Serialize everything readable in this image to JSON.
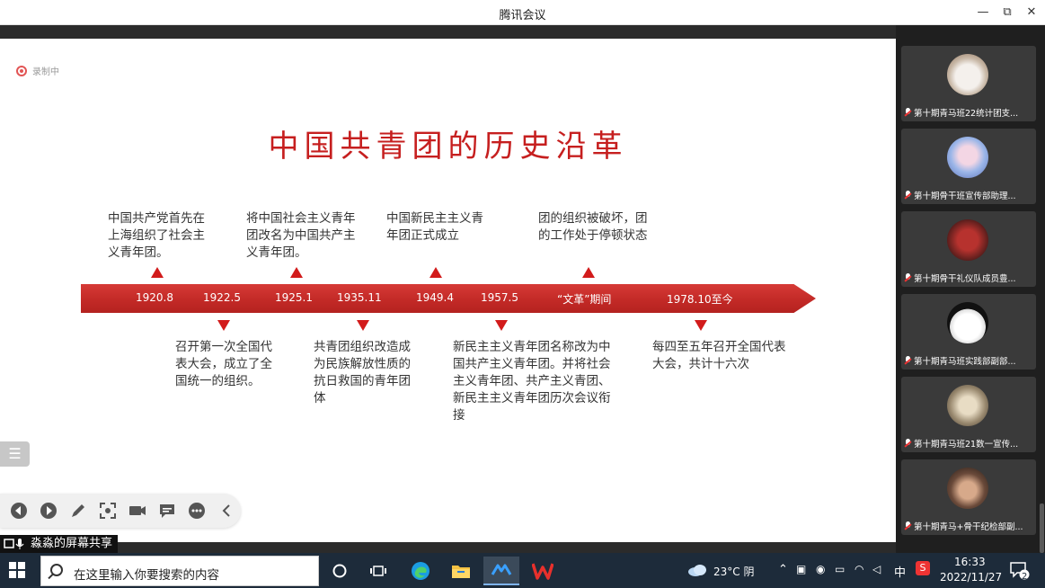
{
  "window": {
    "title": "腾讯会议",
    "minimize": "—",
    "restore": "⧉",
    "close": "✕"
  },
  "recording": {
    "label": "录制中"
  },
  "slide": {
    "title": "中国共青团的历史沿革",
    "timeline": [
      "1920.8",
      "1922.5",
      "1925.1",
      "1935.11",
      "1949.4",
      "1957.5",
      "“文革”期间",
      "1978.10至今"
    ],
    "above_notes": [
      "中国共产党首先在上海组织了社会主义青年团。",
      "将中国社会主义青年团改名为中国共产主义青年团。",
      "中国新民主主义青年团正式成立",
      "团的组织被破坏，团的工作处于停顿状态"
    ],
    "below_notes": [
      "召开第一次全国代表大会，成立了全国统一的组织。",
      "共青团组织改造成为民族解放性质的抗日救国的青年团体",
      "新民主主义青年团名称改为中国共产主义青年团。并将社会主义青年团、共产主义青团、新民主主义青年团历次会议衔接",
      "每四至五年召开全国代表大会，共计十六次"
    ]
  },
  "share_label": "淼淼的屏幕共享",
  "participants": [
    {
      "name": "第十期青马班22统计团支..."
    },
    {
      "name": "第十期骨干班宣传部助理..."
    },
    {
      "name": "第十期骨干礼仪队成员豊..."
    },
    {
      "name": "第十期青马班实践部副部..."
    },
    {
      "name": "第十期青马班21数一宣传..."
    },
    {
      "name": "第十期青马+骨干纪检部副..."
    }
  ],
  "taskbar": {
    "search_placeholder": "在这里输入你要搜索的内容",
    "weather": "23°C 阴",
    "ime": "中",
    "time": "16:33",
    "date": "2022/11/27",
    "notifications": "2"
  },
  "colors": {
    "accent": "#c61f1f",
    "ribbon": "#c9302c",
    "taskbar": "#1d2b3a"
  },
  "icons": [
    "start-icon",
    "search-icon",
    "cortana-icon",
    "task-view-icon",
    "edge-icon",
    "file-explorer-icon",
    "tencent-meeting-icon",
    "wps-icon"
  ]
}
